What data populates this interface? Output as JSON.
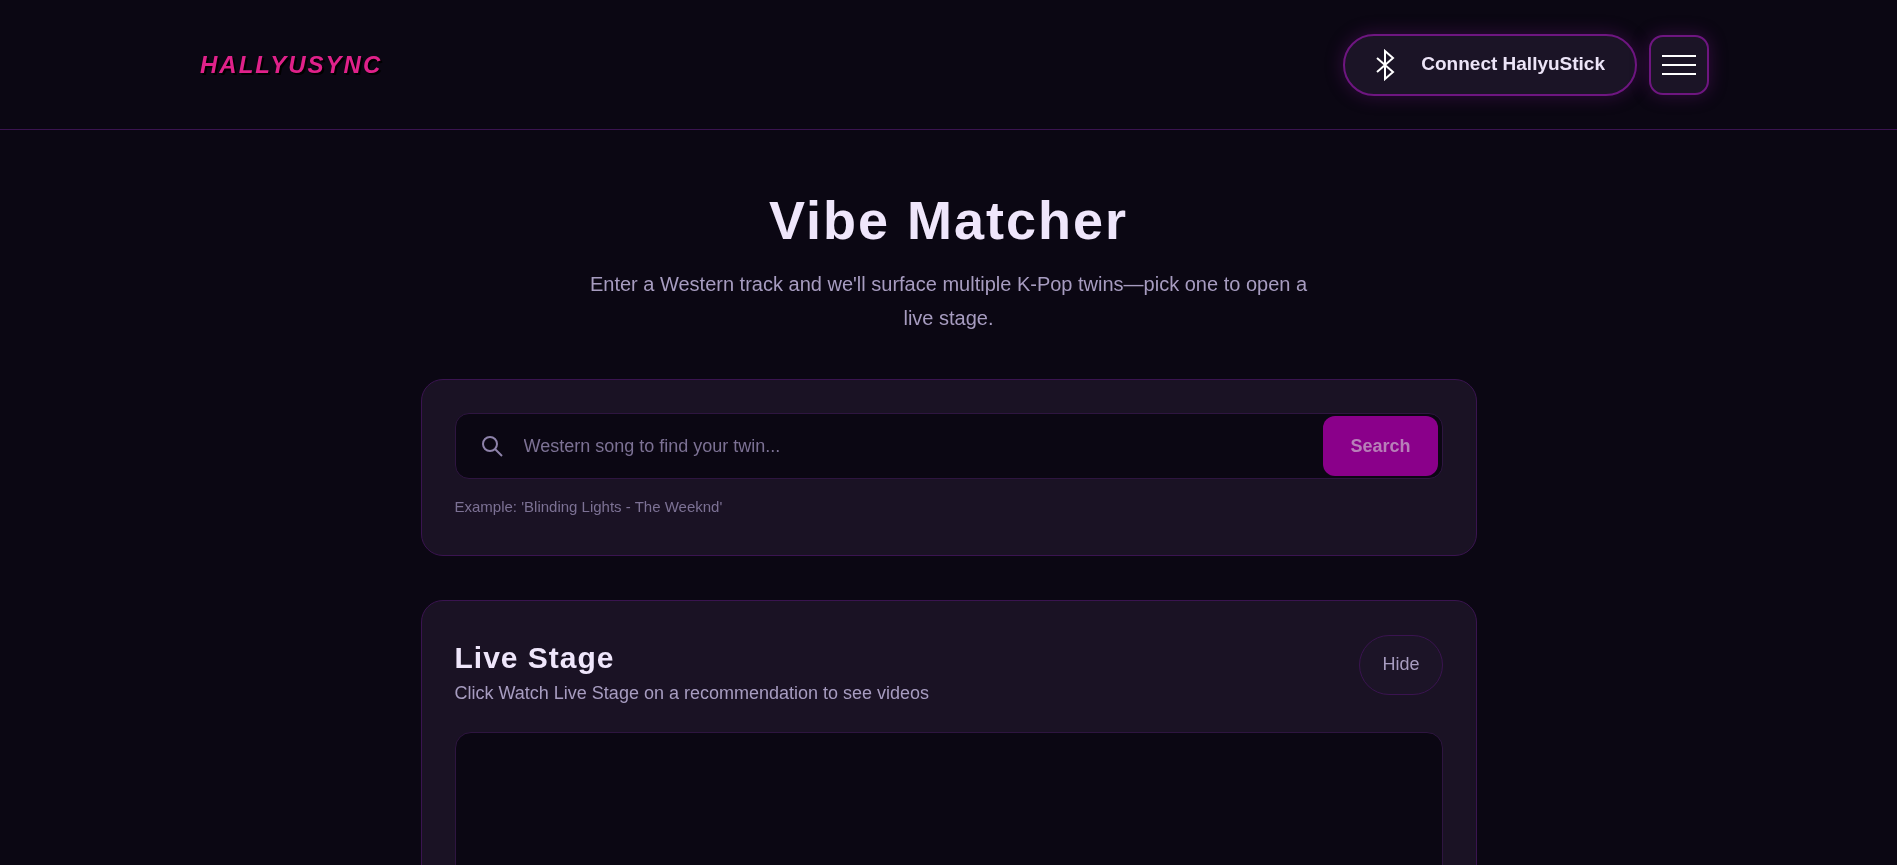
{
  "header": {
    "logo": "HALLYUSYNC",
    "connect_button": "Connect HallyuStick"
  },
  "hero": {
    "title": "Vibe Matcher",
    "subtitle": "Enter a Western track and we'll surface multiple K-Pop twins—pick one to open a live stage."
  },
  "search": {
    "placeholder": "Western song to find your twin...",
    "button": "Search",
    "hint": "Example: 'Blinding Lights - The Weeknd'"
  },
  "live_stage": {
    "title": "Live Stage",
    "subtitle": "Click Watch Live Stage on a recommendation to see videos",
    "hide_button": "Hide"
  }
}
